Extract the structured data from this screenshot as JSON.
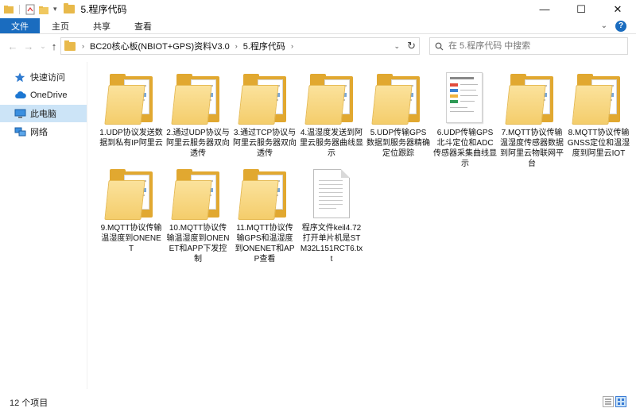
{
  "window": {
    "title": "5.程序代码",
    "controls": {
      "minimize": "—",
      "maximize": "☐",
      "close": "✕"
    }
  },
  "ribbon": {
    "tabs": [
      "文件",
      "主页",
      "共享",
      "查看"
    ]
  },
  "address": {
    "crumbs": [
      "BC20核心板(NBIOT+GPS)资料V3.0",
      "5.程序代码"
    ]
  },
  "search": {
    "placeholder": "在 5.程序代码 中搜索"
  },
  "sidebar": {
    "items": [
      {
        "label": "快速访问",
        "icon": "star-icon"
      },
      {
        "label": "OneDrive",
        "icon": "cloud-icon"
      },
      {
        "label": "此电脑",
        "icon": "computer-icon",
        "selected": true
      },
      {
        "label": "网络",
        "icon": "network-icon"
      }
    ]
  },
  "files": [
    {
      "name": "1.UDP协议发送数据到私有IP阿里云",
      "type": "folder"
    },
    {
      "name": "2.通过UDP协议与阿里云服务器双向透传",
      "type": "folder"
    },
    {
      "name": "3.通过TCP协议与阿里云服务器双向透传",
      "type": "folder"
    },
    {
      "name": "4.温湿度发送到阿里云服务器曲线显示",
      "type": "folder"
    },
    {
      "name": "5.UDP传输GPS数据到服务器精确定位跟踪",
      "type": "folder"
    },
    {
      "name": "6.UDP传输GPS北斗定位和ADC传感器采集曲线显示",
      "type": "folder-pdf"
    },
    {
      "name": "7.MQTT协议传输温湿度传感器数据到阿里云物联网平台",
      "type": "folder"
    },
    {
      "name": "8.MQTT协议传输GNSS定位和温湿度到阿里云IOT",
      "type": "folder"
    },
    {
      "name": "9.MQTT协议传输温湿度到ONENET",
      "type": "folder"
    },
    {
      "name": "10.MQTT协议传输温湿度到ONENET和APP下发控制",
      "type": "folder"
    },
    {
      "name": "11.MQTT协议传输GPS和温湿度到ONENET和APP查看",
      "type": "folder"
    },
    {
      "name": "程序文件keil4.72打开单片机是STM32L151RCT6.txt",
      "type": "text"
    }
  ],
  "status": {
    "count": "12 个项目"
  },
  "colors": {
    "accent": "#1a6cbf",
    "selection": "#cce4f7",
    "folder": "#f4cd6b"
  }
}
